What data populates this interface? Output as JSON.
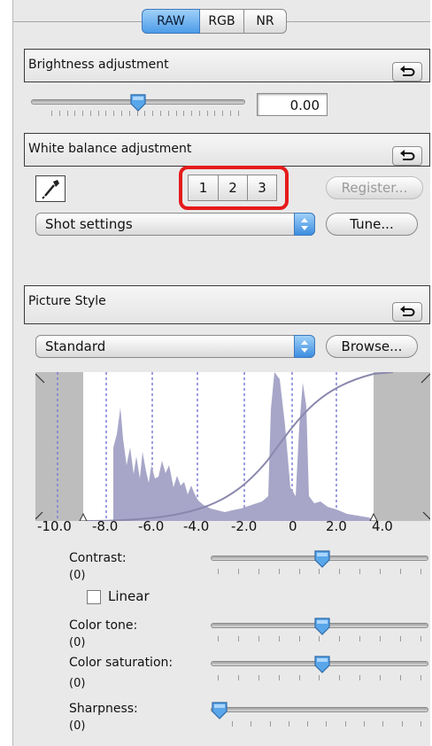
{
  "tabs": [
    "RAW",
    "RGB",
    "NR"
  ],
  "active_tab": "RAW",
  "brightness": {
    "title": "Brightness adjustment",
    "value": "0.00",
    "slider_fraction": 0.5
  },
  "white_balance": {
    "title": "White balance adjustment",
    "presets": [
      "1",
      "2",
      "3"
    ],
    "register_label": "Register...",
    "mode": "Shot settings",
    "tune_label": "Tune..."
  },
  "picture_style": {
    "title": "Picture Style",
    "style": "Standard",
    "browse_label": "Browse...",
    "axis_labels": [
      "-10.0",
      "-8.0",
      "-6.0",
      "-4.0",
      "-2.0",
      "0",
      "2.0",
      "4.0"
    ],
    "params": [
      {
        "label": "Contrast:",
        "value": "(0)",
        "fraction": 0.5
      },
      {
        "label": "Color tone:",
        "value": "(0)",
        "fraction": 0.5
      },
      {
        "label": "Color saturation:",
        "value": "(0)",
        "fraction": 0.5
      },
      {
        "label": "Sharpness:",
        "value": "(0)",
        "fraction": 0.0
      }
    ],
    "linear_label": "Linear",
    "linear_checked": false
  },
  "icons": {
    "reset": "undo-arrow-icon",
    "eyedropper": "eyedropper-icon",
    "popup": "updown-arrows-icon"
  },
  "colors": {
    "accent": "#4d9ce8",
    "highlight": "#e51b1b",
    "histogram": "#a7a6c8"
  }
}
